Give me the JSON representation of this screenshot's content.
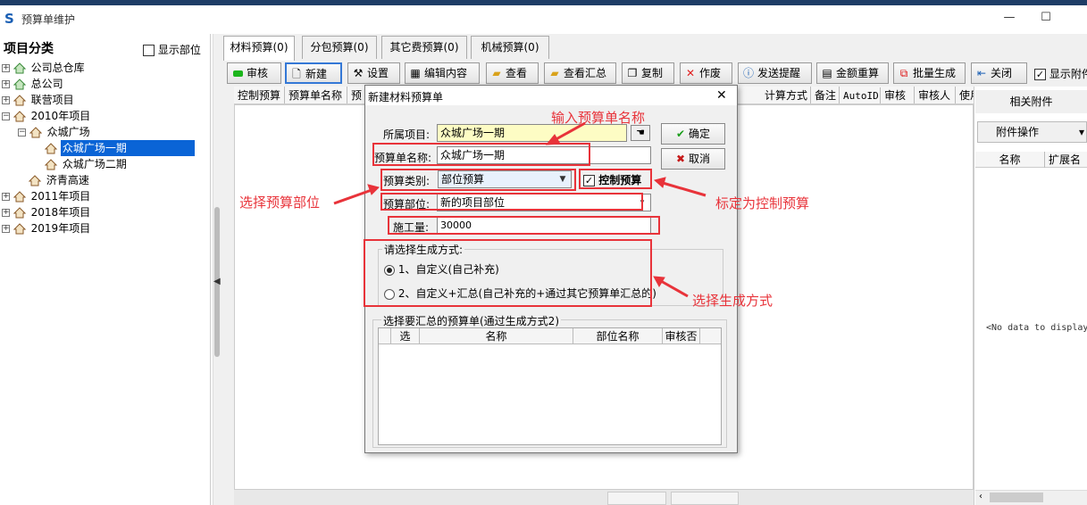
{
  "window": {
    "title": "预算单维护",
    "minimize_glyph": "—",
    "maximize_glyph": "☐"
  },
  "left_panel": {
    "title": "项目分类",
    "show_dept_label": "显示部位",
    "tree": [
      {
        "label": "公司总仓库",
        "toggle": "+",
        "level": 0
      },
      {
        "label": "总公司",
        "toggle": "+",
        "level": 0
      },
      {
        "label": "联营项目",
        "toggle": "+",
        "level": 0
      },
      {
        "label": "2010年项目",
        "toggle": "−",
        "level": 0
      },
      {
        "label": "众城广场",
        "toggle": "−",
        "level": 1
      },
      {
        "label": "众城广场一期",
        "toggle": "",
        "level": 2,
        "selected": true
      },
      {
        "label": "众城广场二期",
        "toggle": "",
        "level": 2
      },
      {
        "label": "济青高速",
        "toggle": "",
        "level": 1
      },
      {
        "label": "2011年项目",
        "toggle": "+",
        "level": 0
      },
      {
        "label": "2018年项目",
        "toggle": "+",
        "level": 0
      },
      {
        "label": "2019年项目",
        "toggle": "+",
        "level": 0
      }
    ]
  },
  "tabs": [
    "材料预算(0)",
    "分包预算(0)",
    "其它费预算(0)",
    "机械预算(0)"
  ],
  "toolbar": {
    "audit": "审核",
    "new": "新建",
    "settings": "设置",
    "edit": "编辑内容",
    "view": "查看",
    "view_summary": "查看汇总",
    "copy": "复制",
    "void": "作废",
    "send_reminder": "发送提醒",
    "recalc": "金额重算",
    "batch_generate": "批量生成",
    "close": "关闭",
    "show_attach": "显示附件"
  },
  "grid_headers": [
    "控制预算",
    "预算单名称",
    "预",
    "计算方式",
    "备注",
    "AutoID",
    "审核",
    "审核人",
    "使用调"
  ],
  "right_panel": {
    "title": "相关附件",
    "op_button": "附件操作",
    "col_name": "名称",
    "col_ext": "扩展名",
    "no_data": "<No data to display>"
  },
  "dialog": {
    "title": "新建材料预算单",
    "project_label": "所属项目:",
    "project_value": "众城广场一期",
    "name_label": "预算单名称:",
    "name_value": "众城广场一期",
    "type_label": "预算类别:",
    "type_value": "部位预算",
    "control_label": "控制预算",
    "dept_label": "预算部位:",
    "dept_value": "新的项目部位",
    "work_label": "施工量:",
    "work_value": "30000",
    "ok": "确定",
    "cancel": "取消",
    "gen_title": "请选择生成方式:",
    "gen_opt1": "1、自定义(自己补充)",
    "gen_opt2": "2、自定义+汇总(自己补充的+通过其它预算单汇总的)",
    "sub_title": "选择要汇总的预算单(通过生成方式2)",
    "sub_headers": [
      "选",
      "名称",
      "部位名称",
      "审核否"
    ]
  },
  "annotations": {
    "enter_name": "输入预算单名称",
    "select_dept": "选择预算部位",
    "mark_control": "标定为控制预算",
    "select_method": "选择生成方式"
  },
  "colors": {
    "accent": "#0a64d6",
    "annotation_red": "#e8333a",
    "title_band": "#1e3d66"
  }
}
